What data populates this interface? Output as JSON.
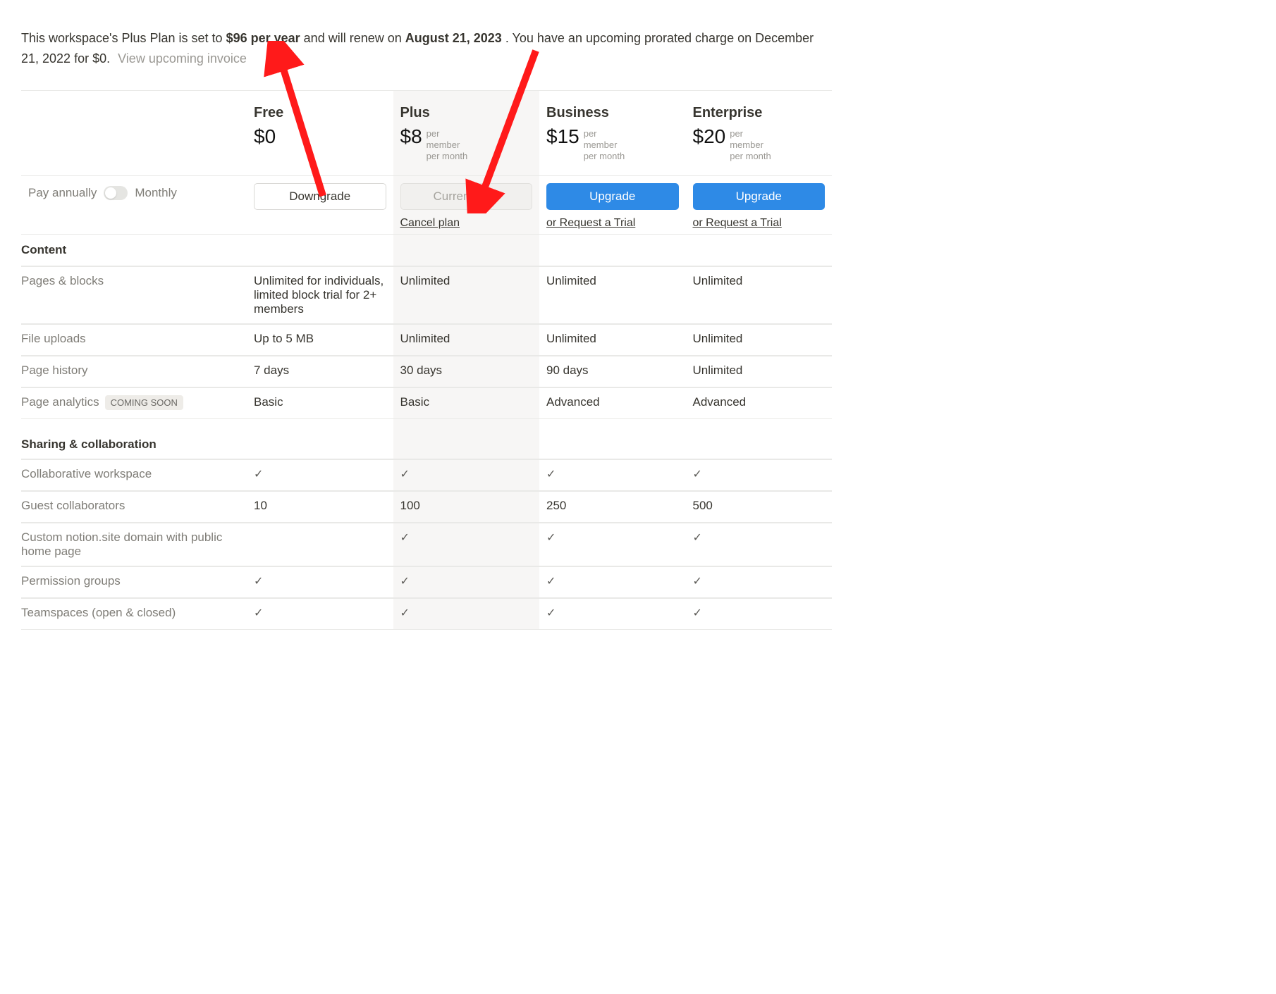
{
  "banner": {
    "prefix": "This workspace's Plus Plan is set to ",
    "price_bold": "$96 per year",
    "mid": " and will renew on ",
    "date_bold": "August 21, 2023",
    "suffix": ". You have an upcoming prorated charge on December 21, 2022 for $0.",
    "invoice_link": "View upcoming invoice"
  },
  "toggle": {
    "label_annual": "Pay annually",
    "label_monthly": "Monthly"
  },
  "plans": {
    "free": {
      "name": "Free",
      "price": "$0",
      "unit": "",
      "cta": "Downgrade",
      "cta_style": "outline",
      "sub": ""
    },
    "plus": {
      "name": "Plus",
      "price": "$8",
      "unit": "per\nmember\nper month",
      "cta": "Current plan",
      "cta_style": "disabled",
      "sub": "Cancel plan"
    },
    "business": {
      "name": "Business",
      "price": "$15",
      "unit": "per\nmember\nper month",
      "cta": "Upgrade",
      "cta_style": "primary",
      "sub": "or Request a Trial"
    },
    "enterprise": {
      "name": "Enterprise",
      "price": "$20",
      "unit": "per\nmember\nper month",
      "cta": "Upgrade",
      "cta_style": "primary",
      "sub": "or Request a Trial"
    }
  },
  "sections": [
    {
      "title": "Content",
      "rows": [
        {
          "label": "Pages & blocks",
          "badge": "",
          "values": [
            "Unlimited for individuals, limited block trial for 2+ members",
            "Unlimited",
            "Unlimited",
            "Unlimited"
          ]
        },
        {
          "label": "File uploads",
          "badge": "",
          "values": [
            "Up to 5 MB",
            "Unlimited",
            "Unlimited",
            "Unlimited"
          ]
        },
        {
          "label": "Page history",
          "badge": "",
          "values": [
            "7 days",
            "30 days",
            "90 days",
            "Unlimited"
          ]
        },
        {
          "label": "Page analytics",
          "badge": "COMING SOON",
          "values": [
            "Basic",
            "Basic",
            "Advanced",
            "Advanced"
          ]
        }
      ]
    },
    {
      "title": "Sharing & collaboration",
      "rows": [
        {
          "label": "Collaborative workspace",
          "badge": "",
          "values": [
            "✓",
            "✓",
            "✓",
            "✓"
          ]
        },
        {
          "label": "Guest collaborators",
          "badge": "",
          "values": [
            "10",
            "100",
            "250",
            "500"
          ]
        },
        {
          "label": "Custom notion.site domain with public home page",
          "badge": "",
          "values": [
            "",
            "✓",
            "✓",
            "✓"
          ]
        },
        {
          "label": "Permission groups",
          "badge": "",
          "values": [
            "✓",
            "✓",
            "✓",
            "✓"
          ]
        },
        {
          "label": "Teamspaces (open & closed)",
          "badge": "",
          "values": [
            "✓",
            "✓",
            "✓",
            "✓"
          ]
        }
      ]
    }
  ]
}
